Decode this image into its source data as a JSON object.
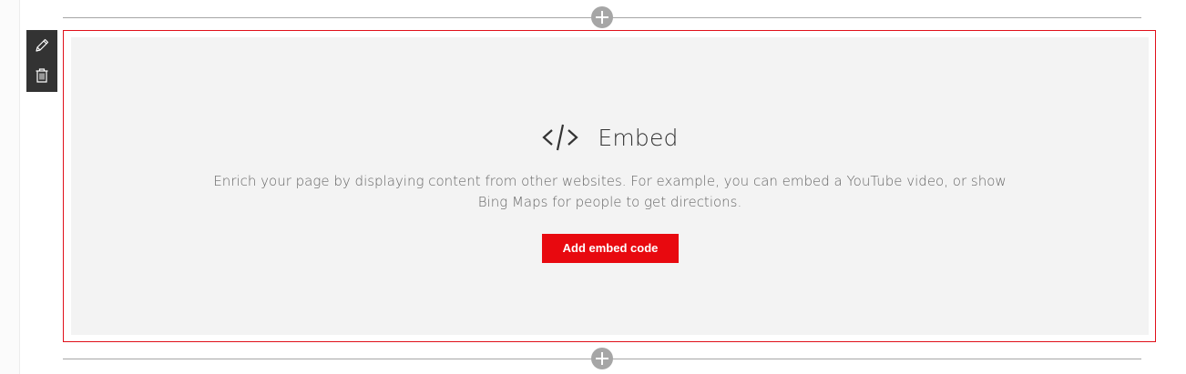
{
  "webpart": {
    "title": "Embed",
    "icon": "code-brackets-icon",
    "description": "Enrich your page by displaying content from other websites. For example, you can embed a YouTube video, or show Bing Maps for people to get directions.",
    "button_label": "Add embed code"
  },
  "toolbar": {
    "items": [
      {
        "icon": "pencil-icon"
      },
      {
        "icon": "trash-icon"
      }
    ]
  },
  "section_controls": {
    "add_icon": "plus-icon"
  },
  "colors": {
    "accent": "#e8090f",
    "frame_border": "#e0101a",
    "placeholder_bg": "#f3f3f3",
    "toolbar_bg": "#333333",
    "divider": "#a6a6a6"
  }
}
